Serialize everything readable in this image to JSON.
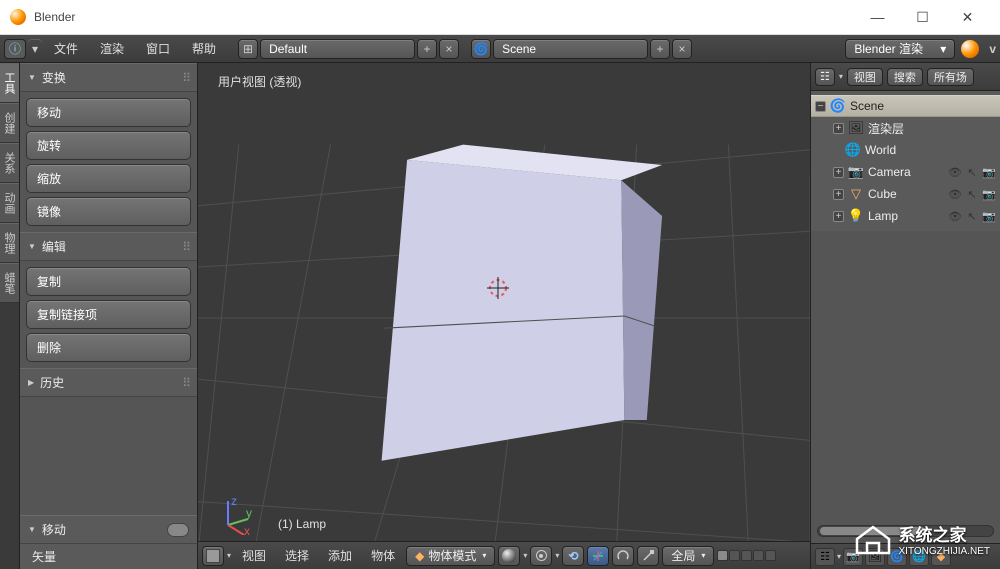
{
  "window": {
    "title": "Blender"
  },
  "menubar": {
    "items": [
      "文件",
      "渲染",
      "窗口",
      "帮助"
    ],
    "layout_preset": "Default",
    "scene_name": "Scene",
    "render_engine": "Blender 渲染",
    "version_prefix": "v"
  },
  "left_tabs": [
    "工具",
    "创建",
    "关系",
    "动画",
    "物理",
    "蜡笔"
  ],
  "tool_panel": {
    "sections": [
      {
        "title": "变换",
        "buttons": [
          "移动",
          "旋转",
          "缩放",
          "镜像"
        ]
      },
      {
        "title": "编辑",
        "buttons": [
          "复制",
          "复制链接项",
          "删除"
        ]
      },
      {
        "title": "历史",
        "buttons": []
      }
    ],
    "bottom": {
      "title": "移动",
      "sub": "矢量"
    }
  },
  "viewport": {
    "label": "用户视图  (透视)",
    "object_label": "(1) Lamp",
    "header": {
      "menus": [
        "视图",
        "选择",
        "添加",
        "物体"
      ],
      "mode": "物体模式",
      "orientation": "全局"
    }
  },
  "outliner": {
    "header_menus": [
      "视图",
      "搜索",
      "所有场"
    ],
    "root": "Scene",
    "children": [
      "渲染层",
      "World",
      "Camera",
      "Cube",
      "Lamp"
    ]
  },
  "watermark": {
    "name": "系统之家",
    "url": "XITONGZHIJIA.NET"
  }
}
